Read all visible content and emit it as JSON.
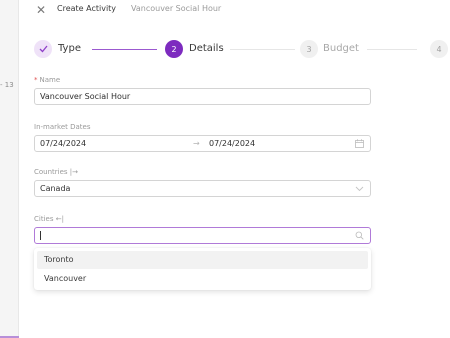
{
  "left_panel": {
    "partial_date": "- 13"
  },
  "header": {
    "title": "Create Activity",
    "subtitle": "Vancouver Social Hour"
  },
  "steps": [
    {
      "number": "1",
      "label": "Type",
      "status": "done"
    },
    {
      "number": "2",
      "label": "Details",
      "status": "active"
    },
    {
      "number": "3",
      "label": "Budget",
      "status": "wait"
    },
    {
      "number": "4",
      "label": "",
      "status": "wait"
    }
  ],
  "form": {
    "name": {
      "label": "Name",
      "value": "Vancouver Social Hour"
    },
    "dates": {
      "label": "In-market Dates",
      "start": "07/24/2024",
      "end": "07/24/2024",
      "separator": "→"
    },
    "countries": {
      "label": "Countries |→",
      "value": "Canada"
    },
    "cities": {
      "label": "Cities ←|",
      "value": "",
      "options": [
        "Toronto",
        "Vancouver"
      ],
      "hovered": "Toronto"
    }
  },
  "colors": {
    "accent": "#7d2bbf",
    "accent_light": "#efe2f8",
    "focus_border": "#b07ad8",
    "required": "#e05050"
  },
  "icons": {
    "close": "close-icon",
    "done": "check-icon",
    "calendar": "calendar-icon",
    "select": "chevron-down-icon",
    "search": "search-icon"
  }
}
